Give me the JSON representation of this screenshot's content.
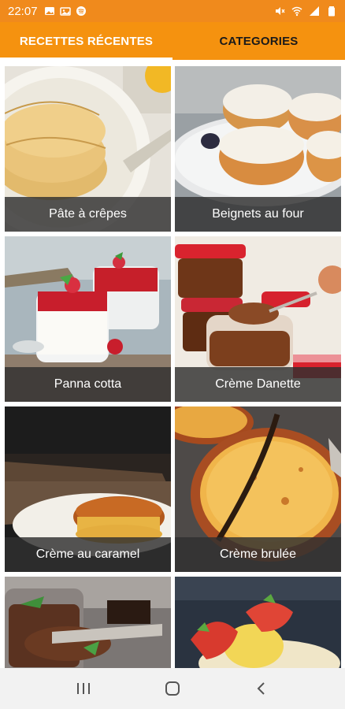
{
  "status_bar": {
    "time": "22:07",
    "left_icons": [
      "gallery-icon",
      "image-icon",
      "spotify-icon"
    ],
    "right_icons": [
      "mute-icon",
      "wifi-icon",
      "signal-icon",
      "battery-icon"
    ]
  },
  "tabs": [
    {
      "label": "RECETTES RÉCENTES",
      "active": true
    },
    {
      "label": "CATEGORIES",
      "active": false
    }
  ],
  "recipes": [
    {
      "title": "Pâte à crêpes"
    },
    {
      "title": "Beignets au four"
    },
    {
      "title": "Panna cotta"
    },
    {
      "title": "Crème Danette"
    },
    {
      "title": "Crème au caramel"
    },
    {
      "title": "Crème brulée"
    },
    {
      "title": ""
    },
    {
      "title": ""
    }
  ],
  "nav_bar": {
    "buttons": [
      "recent-apps-icon",
      "home-icon",
      "back-icon"
    ]
  },
  "colors": {
    "status_bar": "#f08a1c",
    "tab_bar": "#f5920f",
    "caption_bg": "#303030"
  }
}
